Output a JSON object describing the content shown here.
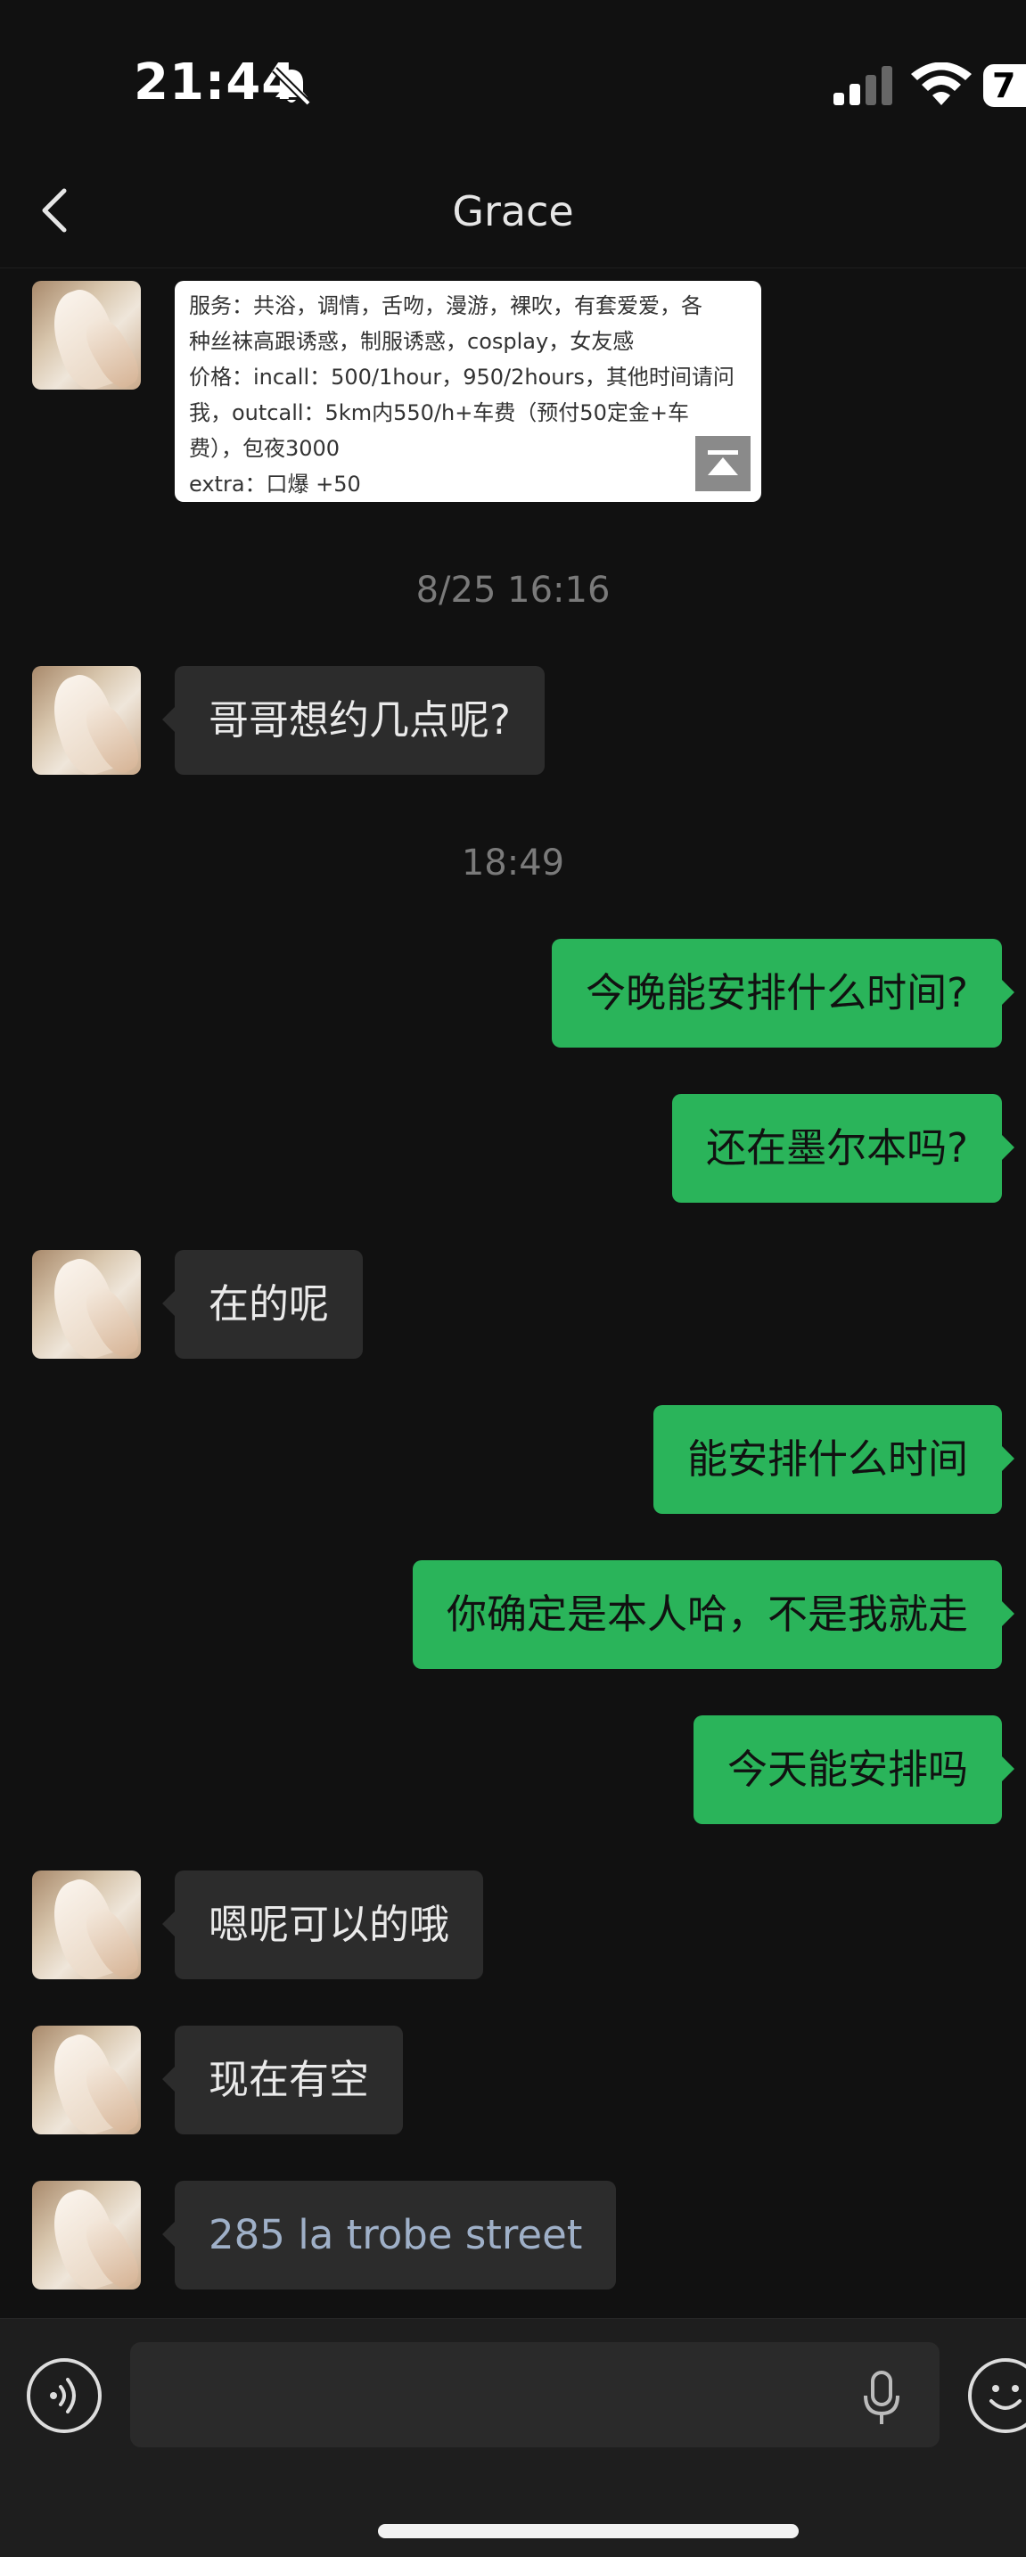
{
  "status_bar": {
    "time": "21:44",
    "battery": "7"
  },
  "header": {
    "title": "Grace"
  },
  "card": {
    "lines": [
      "服务：共浴，调情，舌吻，漫游，裸吹，有套爱爱，各",
      "种丝袜高跟诱惑，制服诱惑，cosplay，女友感",
      "价格：incall：500/1hour，950/2hours，其他时间请问",
      "我，outcall：5km内550/h+车费（预付50定金+车",
      "费），包夜3000",
      "extra：口爆 +50"
    ]
  },
  "timestamps": {
    "t1": "8/25 16:16",
    "t2": "18:49"
  },
  "messages": [
    {
      "side": "in",
      "text": "哥哥想约几点呢?"
    },
    {
      "side": "out",
      "text": "今晚能安排什么时间?"
    },
    {
      "side": "out",
      "text": "还在墨尔本吗?"
    },
    {
      "side": "in",
      "text": "在的呢"
    },
    {
      "side": "out",
      "text": "能安排什么时间"
    },
    {
      "side": "out",
      "text": "你确定是本人哈，不是我就走"
    },
    {
      "side": "out",
      "text": "今天能安排吗"
    },
    {
      "side": "in",
      "text": "嗯呢可以的哦"
    },
    {
      "side": "in",
      "text": "现在有空"
    },
    {
      "side": "in",
      "text": "285 la trobe street"
    }
  ],
  "input": {
    "value": "",
    "placeholder": ""
  },
  "icons": {
    "back": "chevron-left-icon",
    "bell_muted": "bell-slash-icon",
    "voice": "voice-icon",
    "mic": "microphone-icon",
    "emoji": "emoji-icon"
  },
  "colors": {
    "outgoing": "#2ab45a",
    "incoming": "#2c2c2c",
    "background": "#111111"
  }
}
